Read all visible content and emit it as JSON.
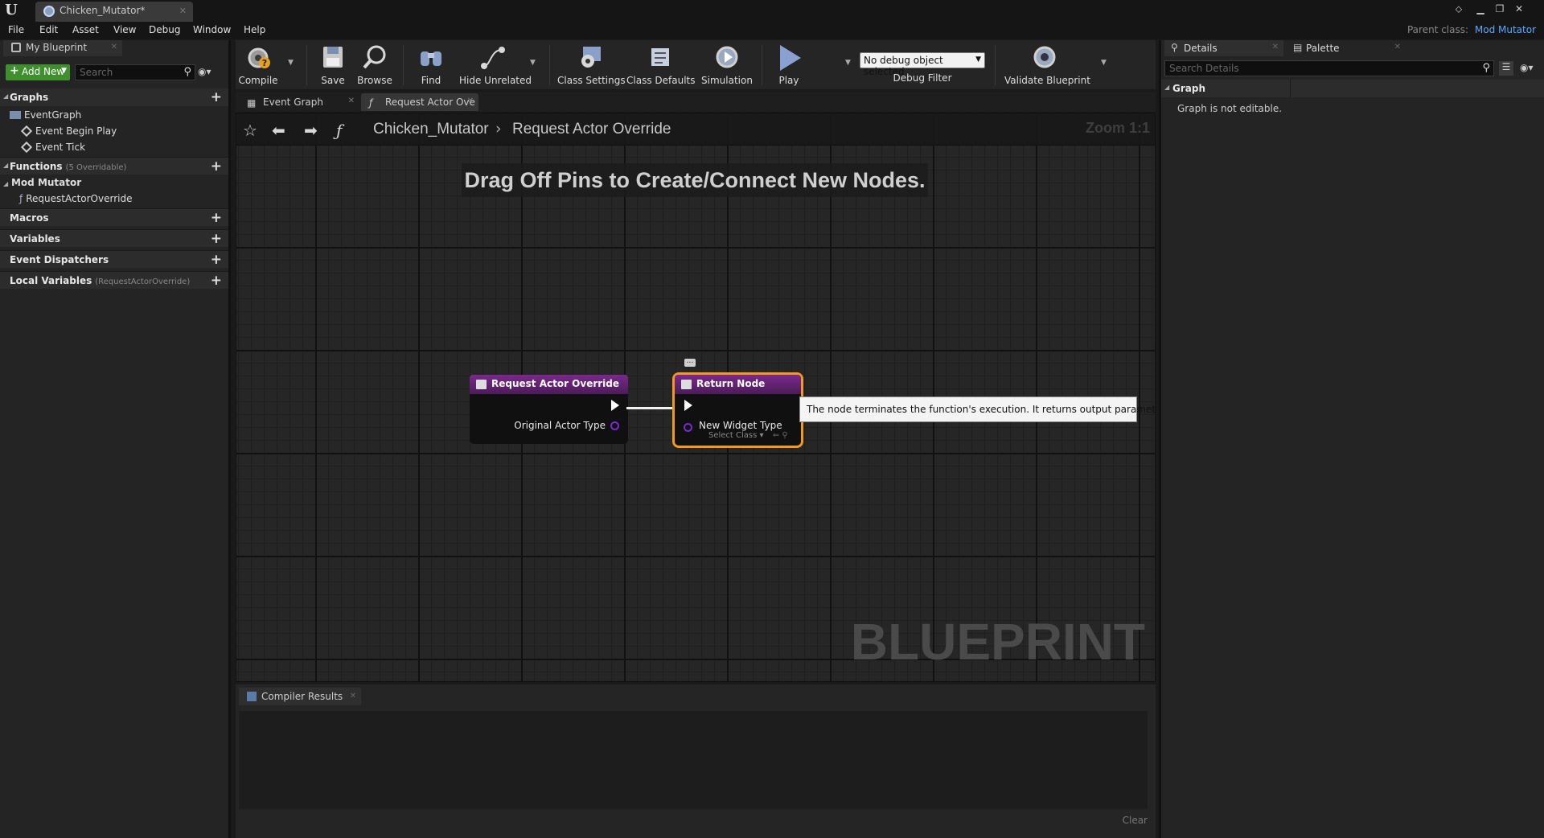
{
  "window": {
    "tab_title": "Chicken_Mutator*",
    "parent_class_label": "Parent class:",
    "parent_class_value": "Mod Mutator"
  },
  "menu": [
    "File",
    "Edit",
    "Asset",
    "View",
    "Debug",
    "Window",
    "Help"
  ],
  "left_panel": {
    "tab_label": "My Blueprint",
    "add_new_label": "Add New",
    "search_placeholder": "Search",
    "sections": {
      "graphs": "Graphs",
      "functions": "Functions",
      "functions_sub": "(5 Overridable)",
      "mod_mutator": "Mod Mutator",
      "macros": "Macros",
      "variables": "Variables",
      "event_dispatchers": "Event Dispatchers",
      "local_variables": "Local Variables",
      "local_variables_sub": "(RequestActorOverride)"
    },
    "graph_items": [
      "EventGraph",
      "Event Begin Play",
      "Event Tick"
    ],
    "function_items": [
      "RequestActorOverride"
    ]
  },
  "toolbar": {
    "compile": "Compile",
    "save": "Save",
    "browse": "Browse",
    "find": "Find",
    "hide_unrelated": "Hide Unrelated",
    "class_settings": "Class Settings",
    "class_defaults": "Class Defaults",
    "simulation": "Simulation",
    "play": "Play",
    "debug_object": "No debug object selected",
    "debug_filter": "Debug Filter",
    "validate": "Validate Blueprint"
  },
  "graph_tabs": [
    "Event Graph",
    "Request Actor Ove"
  ],
  "graph": {
    "breadcrumb_root": "Chicken_Mutator",
    "breadcrumb_leaf": "Request Actor Override",
    "zoom": "Zoom 1:1",
    "hint": "Drag Off Pins to Create/Connect New Nodes.",
    "watermark": "BLUEPRINT",
    "node1": {
      "title": "Request Actor Override",
      "pin": "Original Actor Type"
    },
    "node2": {
      "title": "Return Node",
      "pin": "New Widget Type",
      "select": "Select Class"
    },
    "tooltip": "The node terminates the function's execution. It returns output parameters."
  },
  "compiler": {
    "tab_label": "Compiler Results",
    "clear_label": "Clear"
  },
  "right_panel": {
    "details_tab": "Details",
    "palette_tab": "Palette",
    "search_placeholder": "Search Details",
    "category": "Graph",
    "message": "Graph is not editable."
  }
}
